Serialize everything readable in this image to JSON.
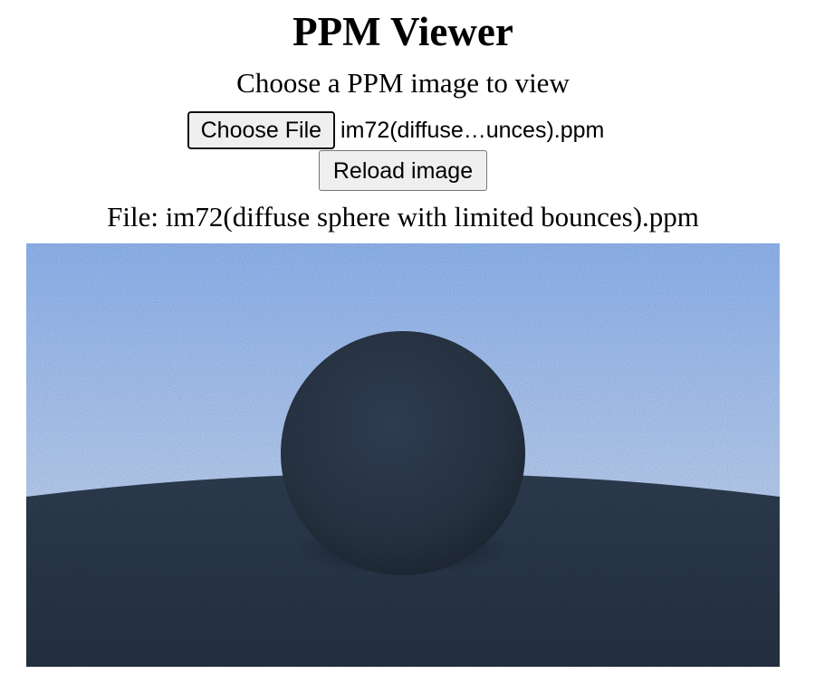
{
  "page": {
    "title": "PPM Viewer",
    "subtitle": "Choose a PPM image to view"
  },
  "file_input": {
    "button_label": "Choose File",
    "selected_file_display": "im72(diffuse…unces).ppm"
  },
  "reload_button": {
    "label": "Reload image"
  },
  "file_info": {
    "label": "File: im72(diffuse sphere with limited bounces).ppm"
  },
  "render": {
    "sky_top_color": "#96bdfb",
    "sky_bottom_color": "#dbe7fb",
    "ground_color": "#2b3a4d",
    "sphere_color": "#2c3949"
  }
}
